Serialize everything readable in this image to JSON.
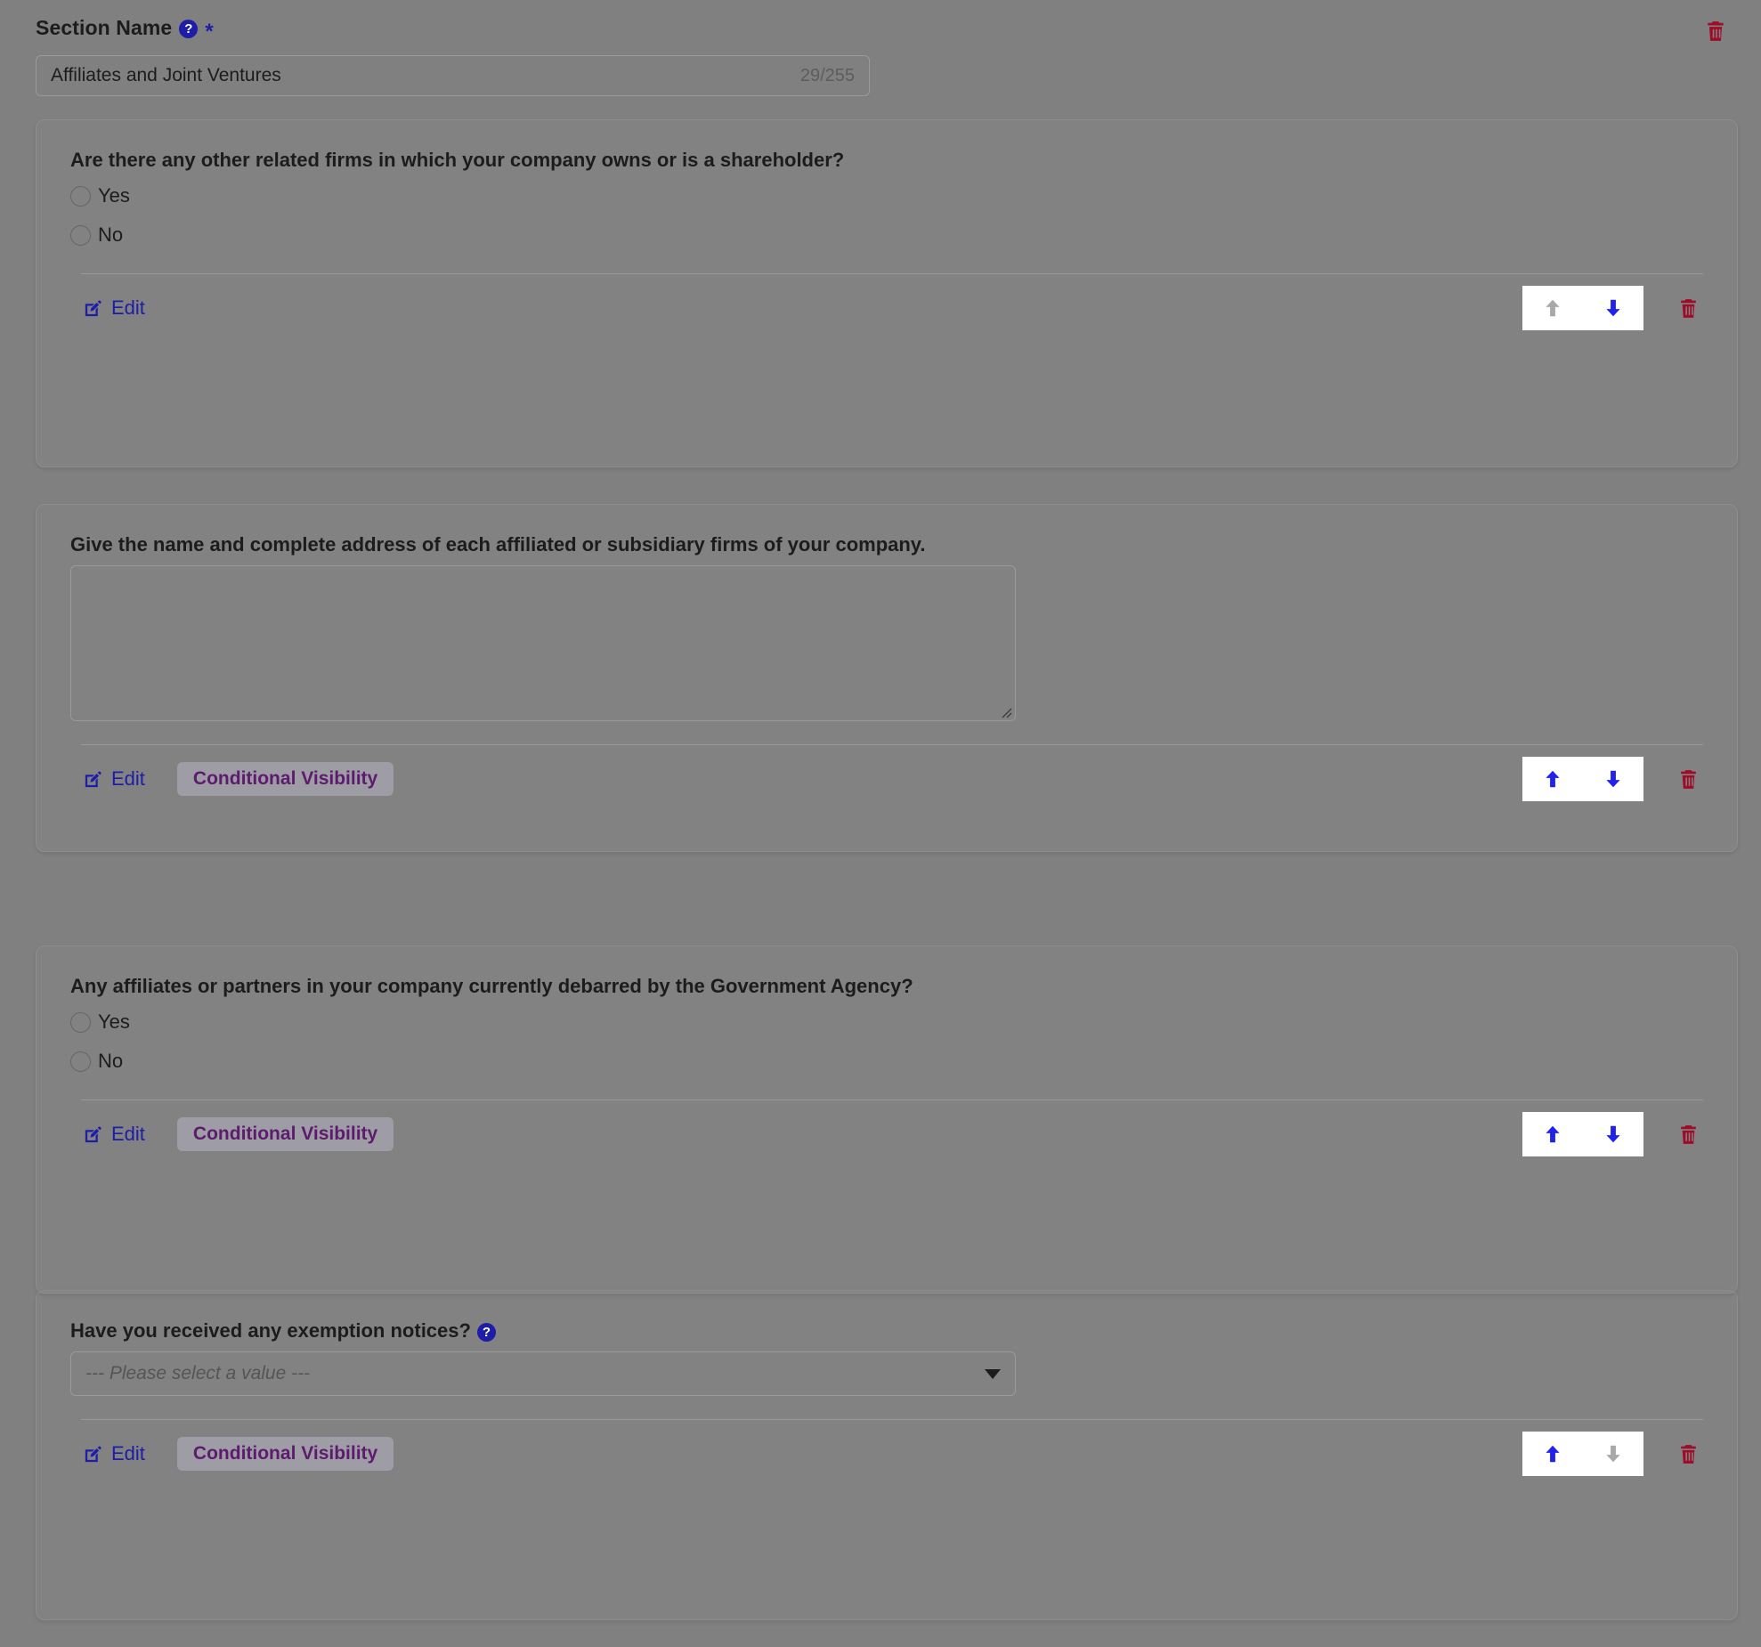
{
  "colors": {
    "page_background": "#808080",
    "accent_blue": "#1d1da8",
    "arrow_active": "#2222ee",
    "arrow_disabled": "#a8a8a8",
    "delete_red": "#9e0c28",
    "badge_text_purple": "#5d1b6e",
    "text_primary": "#1c1c1c"
  },
  "section": {
    "label": "Section Name",
    "help_icon": "help-circle-icon",
    "required_marker": "*",
    "delete_icon": "trash-icon",
    "name_input": {
      "value": "Affiliates and Joint Ventures",
      "placeholder": "Section Name",
      "counter": "29/255"
    }
  },
  "footer_labels": {
    "edit": "Edit",
    "edit_icon": "edit-pencil-icon",
    "conditional_visibility": "Conditional Visibility",
    "move_up_icon": "arrow-up-icon",
    "move_down_icon": "arrow-down-icon",
    "delete_icon": "trash-icon"
  },
  "questions": [
    {
      "id": "q1",
      "title": "Are there any other related firms in which your company owns or is a shareholder?",
      "type": "radio",
      "has_help": false,
      "options": [
        {
          "label": "Yes",
          "selected": false
        },
        {
          "label": "No",
          "selected": false
        }
      ],
      "edit_label": "Edit",
      "has_conditional_visibility": false,
      "move_up_enabled": false,
      "move_down_enabled": true
    },
    {
      "id": "q2",
      "title": "Give the name and complete address of each affiliated or subsidiary firms of your company.",
      "type": "textarea",
      "has_help": false,
      "textarea_value": "",
      "textarea_placeholder": "",
      "edit_label": "Edit",
      "has_conditional_visibility": true,
      "conditional_visibility_label": "Conditional Visibility",
      "move_up_enabled": true,
      "move_down_enabled": true
    },
    {
      "id": "q3",
      "title": "Any affiliates or partners in your company currently debarred by the Government Agency?",
      "type": "radio",
      "has_help": false,
      "options": [
        {
          "label": "Yes",
          "selected": false
        },
        {
          "label": "No",
          "selected": false
        }
      ],
      "edit_label": "Edit",
      "has_conditional_visibility": true,
      "conditional_visibility_label": "Conditional Visibility",
      "move_up_enabled": true,
      "move_down_enabled": true
    },
    {
      "id": "q4",
      "title": "Have you received any exemption notices?",
      "type": "select",
      "has_help": true,
      "help_icon": "help-circle-icon",
      "select_value": "--- Please select a value ---",
      "edit_label": "Edit",
      "has_conditional_visibility": true,
      "conditional_visibility_label": "Conditional Visibility",
      "move_up_enabled": true,
      "move_down_enabled": false
    }
  ]
}
